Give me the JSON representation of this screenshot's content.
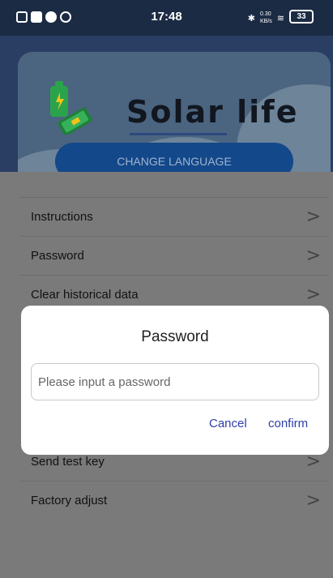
{
  "status_bar": {
    "time": "17:48",
    "net_speed_top": "0.30",
    "net_speed_bottom": "KB/s",
    "battery": "33"
  },
  "app": {
    "title": "Solar life",
    "change_language_label": "CHANGE LANGUAGE"
  },
  "menu": {
    "items_top": [
      {
        "label": "Instructions"
      },
      {
        "label": "Password"
      },
      {
        "label": "Clear historical data"
      }
    ],
    "items_bottom": [
      {
        "label": "Send test key"
      },
      {
        "label": "Factory adjust"
      }
    ],
    "chevron": ">"
  },
  "dialog": {
    "title": "Password",
    "input_placeholder": "Please input a password",
    "input_value": "",
    "cancel_label": "Cancel",
    "confirm_label": "confirm"
  },
  "colors": {
    "accent": "#2e3fa8",
    "button": "#13488a",
    "overlay": "#7a7a7a"
  }
}
